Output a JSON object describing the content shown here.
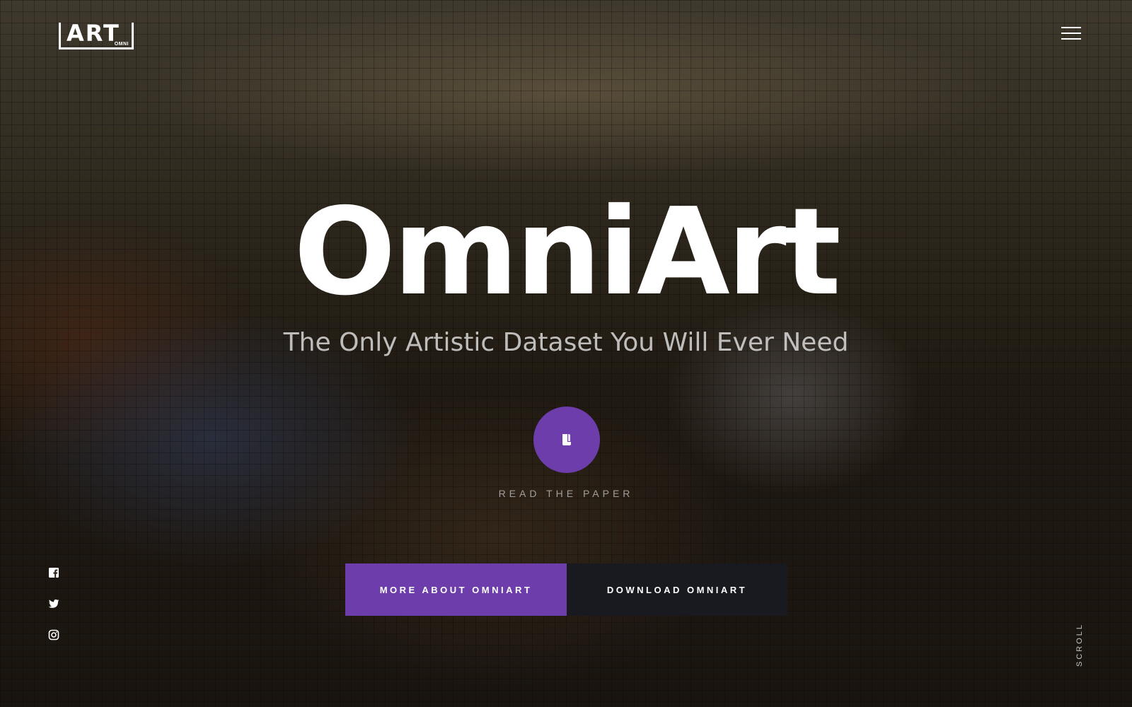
{
  "logo": {
    "main": "ART",
    "sub": "OMNI"
  },
  "header": {
    "menu_icon": "hamburger-menu-icon"
  },
  "hero": {
    "title": "OmniArt",
    "subtitle": "The Only Artistic Dataset You Will Ever Need",
    "paper_icon": "document-icon",
    "paper_label": "READ THE PAPER"
  },
  "cta": {
    "primary_label": "MORE ABOUT OMNIART",
    "secondary_label": "DOWNLOAD OMNIART"
  },
  "social": {
    "items": [
      "facebook-icon",
      "twitter-icon",
      "instagram-icon"
    ]
  },
  "scroll_label": "SCROLL",
  "colors": {
    "accent": "#6c3dab",
    "dark_button": "#181a20",
    "text": "#ffffff"
  }
}
